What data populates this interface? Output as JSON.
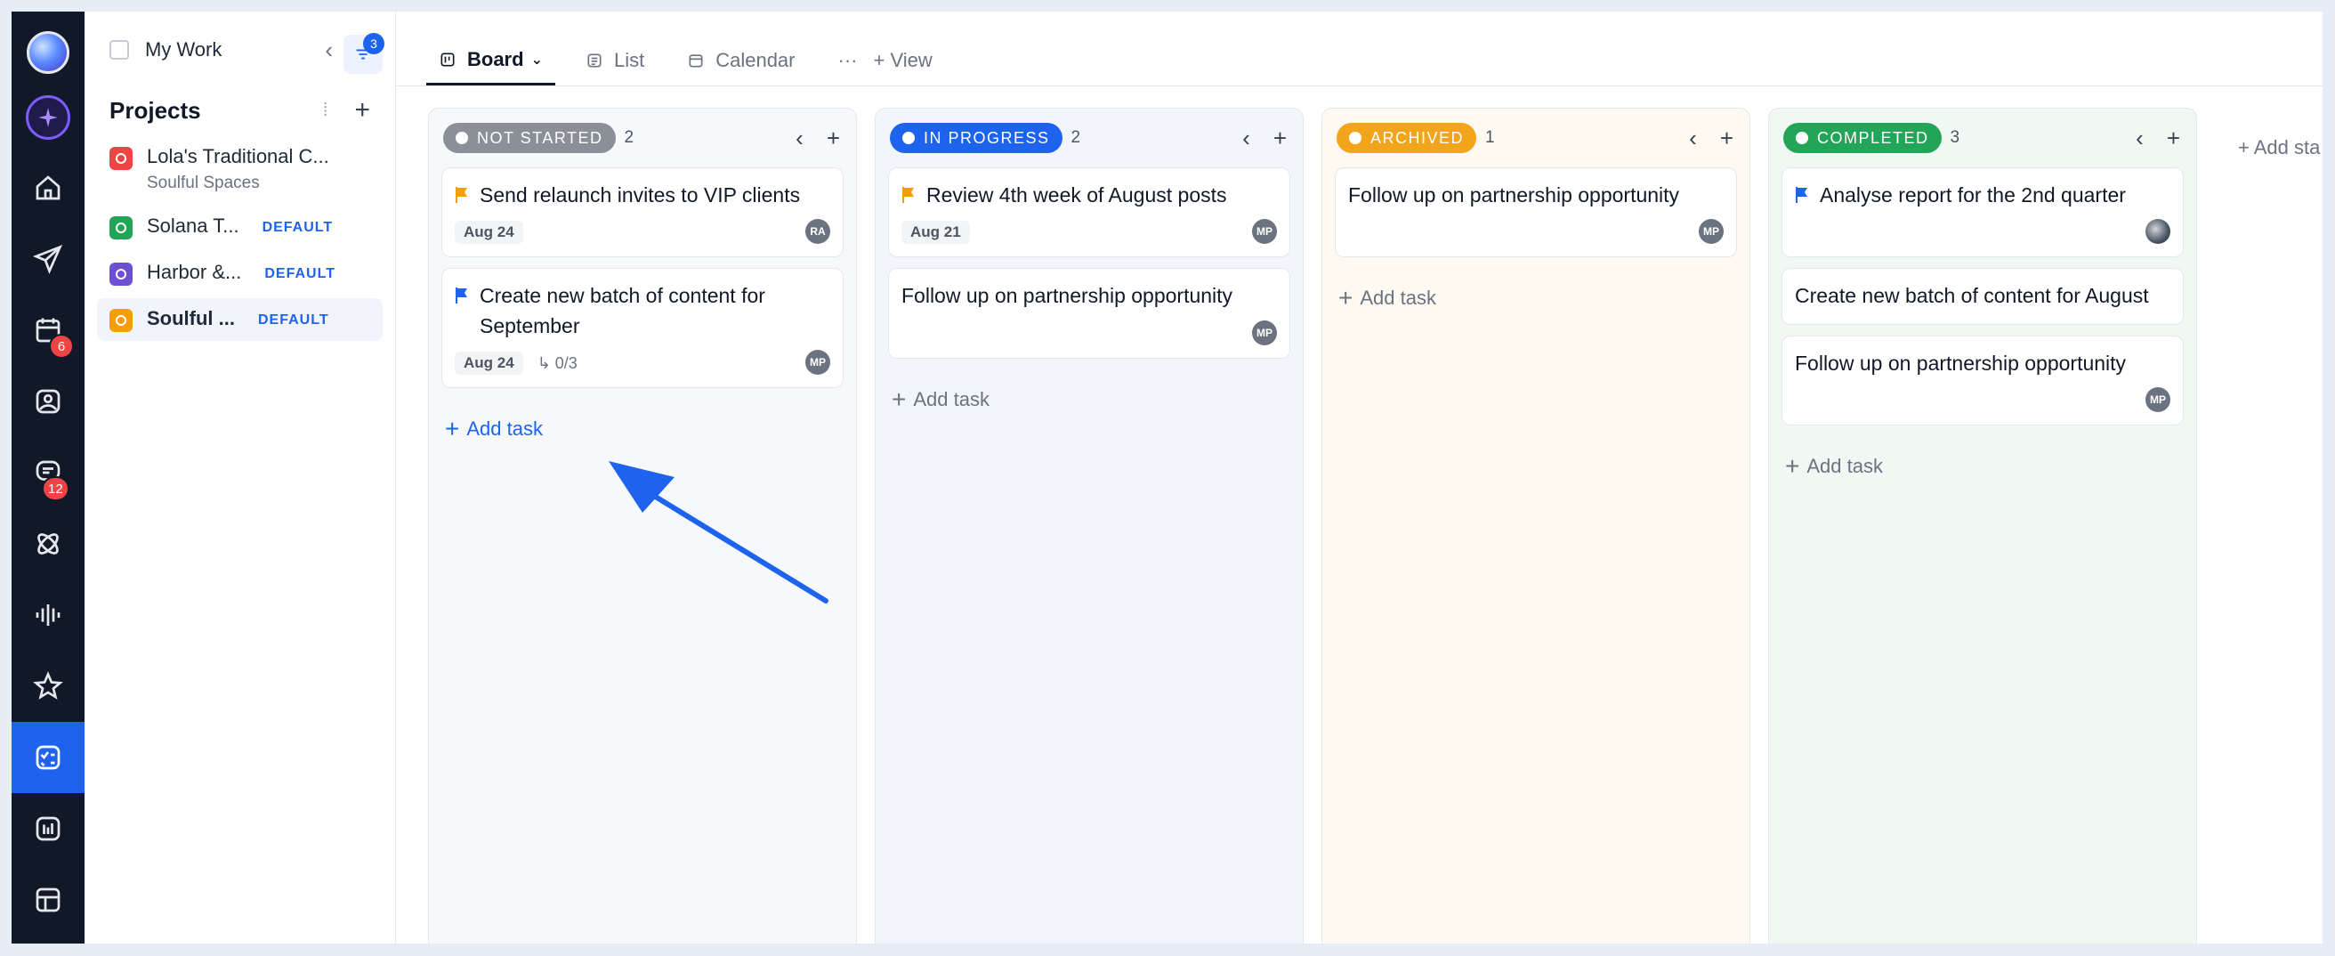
{
  "rail": {
    "calendar_badge": "6",
    "chat_badge": "12"
  },
  "sidebar": {
    "my_work": "My Work",
    "filter_count": "3",
    "projects_title": "Projects",
    "projects": [
      {
        "name": "Lola's Traditional C...",
        "sub": "Soulful Spaces",
        "color": "#ef4444",
        "tag": ""
      },
      {
        "name": "Solana T...",
        "sub": "",
        "color": "#22a559",
        "tag": "DEFAULT"
      },
      {
        "name": "Harbor &...",
        "sub": "",
        "color": "#6d4fd1",
        "tag": "DEFAULT"
      },
      {
        "name": "Soulful ...",
        "sub": "",
        "color": "#f59e0b",
        "tag": "DEFAULT"
      }
    ]
  },
  "views": {
    "board": "Board",
    "list": "List",
    "calendar": "Calendar",
    "more": "···",
    "add_view": "+ View"
  },
  "columns": [
    {
      "status": "NOT STARTED",
      "color": "#8a8f98",
      "bg": "#f6f8fb",
      "count": "2",
      "cards": [
        {
          "title": "Send relaunch invites to VIP clients",
          "flag": "#f59e0b",
          "date": "Aug 24",
          "subtasks": "",
          "avatar": "RA"
        },
        {
          "title": "Create new batch of content for September",
          "flag": "#1d63ed",
          "date": "Aug 24",
          "subtasks": "0/3",
          "avatar": "MP"
        }
      ],
      "add_label": "Add task"
    },
    {
      "status": "IN PROGRESS",
      "color": "#1d63ed",
      "bg": "#f2f6fc",
      "count": "2",
      "cards": [
        {
          "title": "Review 4th week of August posts",
          "flag": "#f59e0b",
          "date": "Aug 21",
          "subtasks": "",
          "avatar": "MP"
        },
        {
          "title": "Follow up on partnership opportunity",
          "flag": "",
          "date": "",
          "subtasks": "",
          "avatar": "MP"
        }
      ],
      "add_label": "Add task"
    },
    {
      "status": "ARCHIVED",
      "color": "#f2a51a",
      "bg": "#fffaf1",
      "count": "1",
      "cards": [
        {
          "title": "Follow up on partnership opportunity",
          "flag": "",
          "date": "",
          "subtasks": "",
          "avatar": "MP"
        }
      ],
      "add_label": "Add task"
    },
    {
      "status": "COMPLETED",
      "color": "#22a559",
      "bg": "#f1f8f3",
      "count": "3",
      "cards": [
        {
          "title": "Analyse report for the 2nd quarter",
          "flag": "#1d63ed",
          "date": "",
          "subtasks": "",
          "avatar": "photo"
        },
        {
          "title": "Create new batch of content for August",
          "flag": "",
          "date": "",
          "subtasks": "",
          "avatar": ""
        },
        {
          "title": "Follow up on partnership opportunity",
          "flag": "",
          "date": "",
          "subtasks": "",
          "avatar": "MP"
        }
      ],
      "add_label": "Add task"
    }
  ],
  "add_stage": "+ Add sta"
}
